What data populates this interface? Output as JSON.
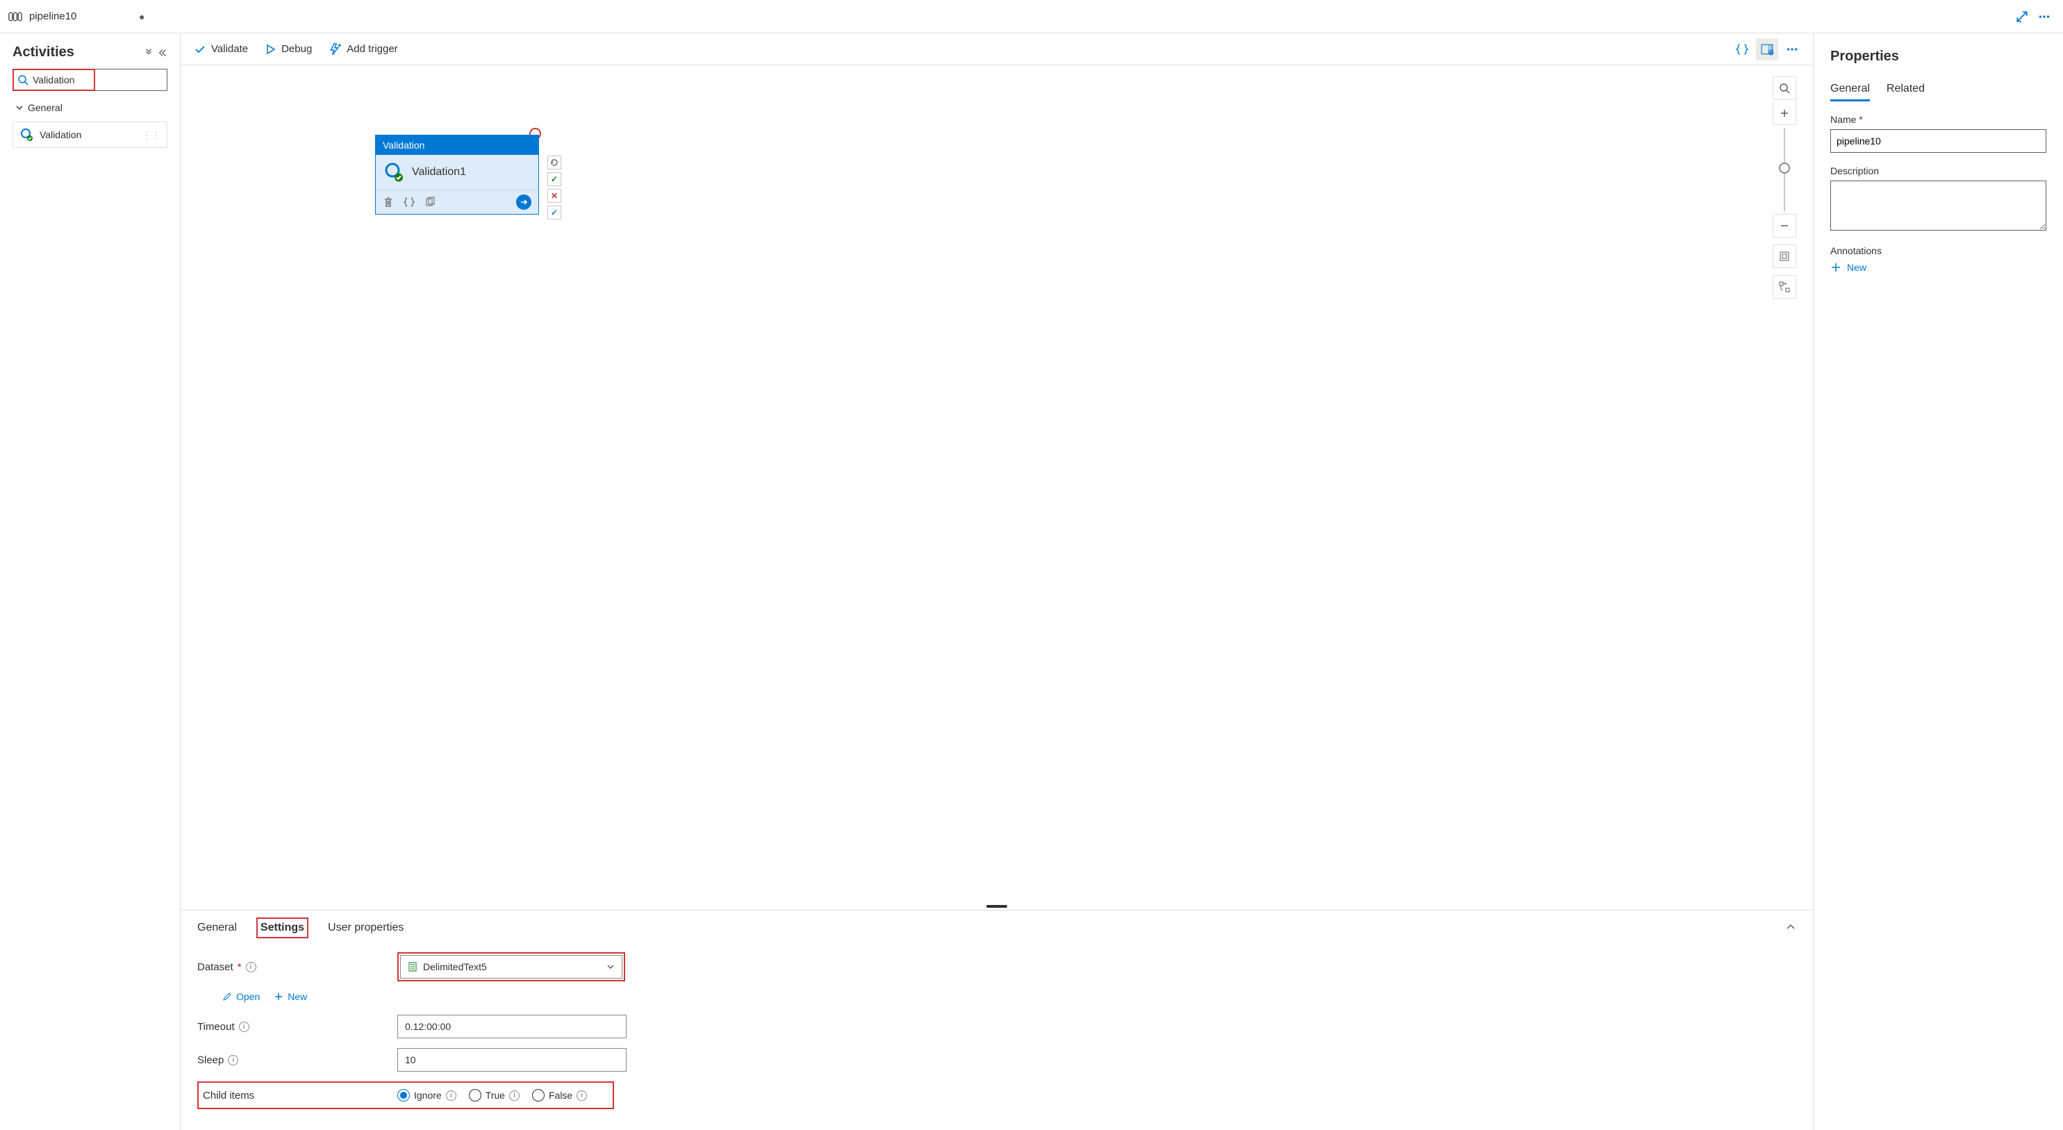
{
  "tab": {
    "title": "pipeline10"
  },
  "sidebar": {
    "title": "Activities",
    "search_value": "Validation",
    "groups": [
      {
        "label": "General",
        "items": [
          {
            "label": "Validation"
          }
        ]
      }
    ]
  },
  "toolbar": {
    "validate": "Validate",
    "debug": "Debug",
    "add_trigger": "Add trigger"
  },
  "canvas": {
    "activity": {
      "type_label": "Validation",
      "name": "Validation1"
    }
  },
  "bottom": {
    "tabs": [
      "General",
      "Settings",
      "User properties"
    ],
    "active_tab": "Settings",
    "dataset_label": "Dataset",
    "dataset_value": "DelimitedText5",
    "open_label": "Open",
    "new_label": "New",
    "timeout_label": "Timeout",
    "timeout_value": "0.12:00:00",
    "sleep_label": "Sleep",
    "sleep_value": "10",
    "child_items_label": "Child items",
    "child_items_options": [
      "Ignore",
      "True",
      "False"
    ],
    "child_items_selected": "Ignore"
  },
  "props": {
    "title": "Properties",
    "tabs": [
      "General",
      "Related"
    ],
    "active_tab": "General",
    "name_label": "Name",
    "name_value": "pipeline10",
    "description_label": "Description",
    "description_value": "",
    "annotations_label": "Annotations",
    "annotations_new": "New"
  }
}
